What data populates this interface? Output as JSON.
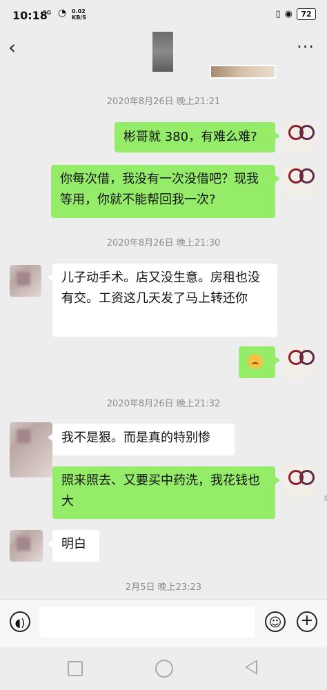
{
  "status_bar": {
    "time": "10:18",
    "network": "3G",
    "speed_value": "0.02",
    "speed_unit": "KB/S",
    "battery": "72",
    "icons": [
      "signal-icon",
      "wifi-icon",
      "vibrate-icon",
      "lock-icon",
      "battery-icon"
    ]
  },
  "nav": {
    "back_icon": "chevron-left-icon",
    "more_label": "···"
  },
  "messages": {
    "ts1": "2020年8月26日 晚上21:21",
    "m1": "彬哥就 380，有难么难?",
    "m2": "你每次借，我没有一次没借吧？现我等用，你就不能帮回我一次?",
    "ts2": "2020年8月26日 晚上21:30",
    "m3": "儿子动手术。店又没生意。房租也没有交。工资这几天发了马上转还你",
    "m4_icon": "annoyed-emoji-icon",
    "ts3": "2020年8月26日 晚上21:32",
    "m5": "我不是狠。而是真的特别惨",
    "m6": "照来照去、又要买中药洗，我花钱也大",
    "m7": "明白",
    "ts4": "2月5日 晚上23:23"
  },
  "input_bar": {
    "voice_icon": "voice-icon",
    "text_value": "",
    "emoji_icon": "emoji-icon",
    "plus_icon": "plus-icon"
  },
  "system_nav": {
    "recent_icon": "square-icon",
    "home_icon": "circle-icon",
    "back_icon": "triangle-back-icon"
  }
}
